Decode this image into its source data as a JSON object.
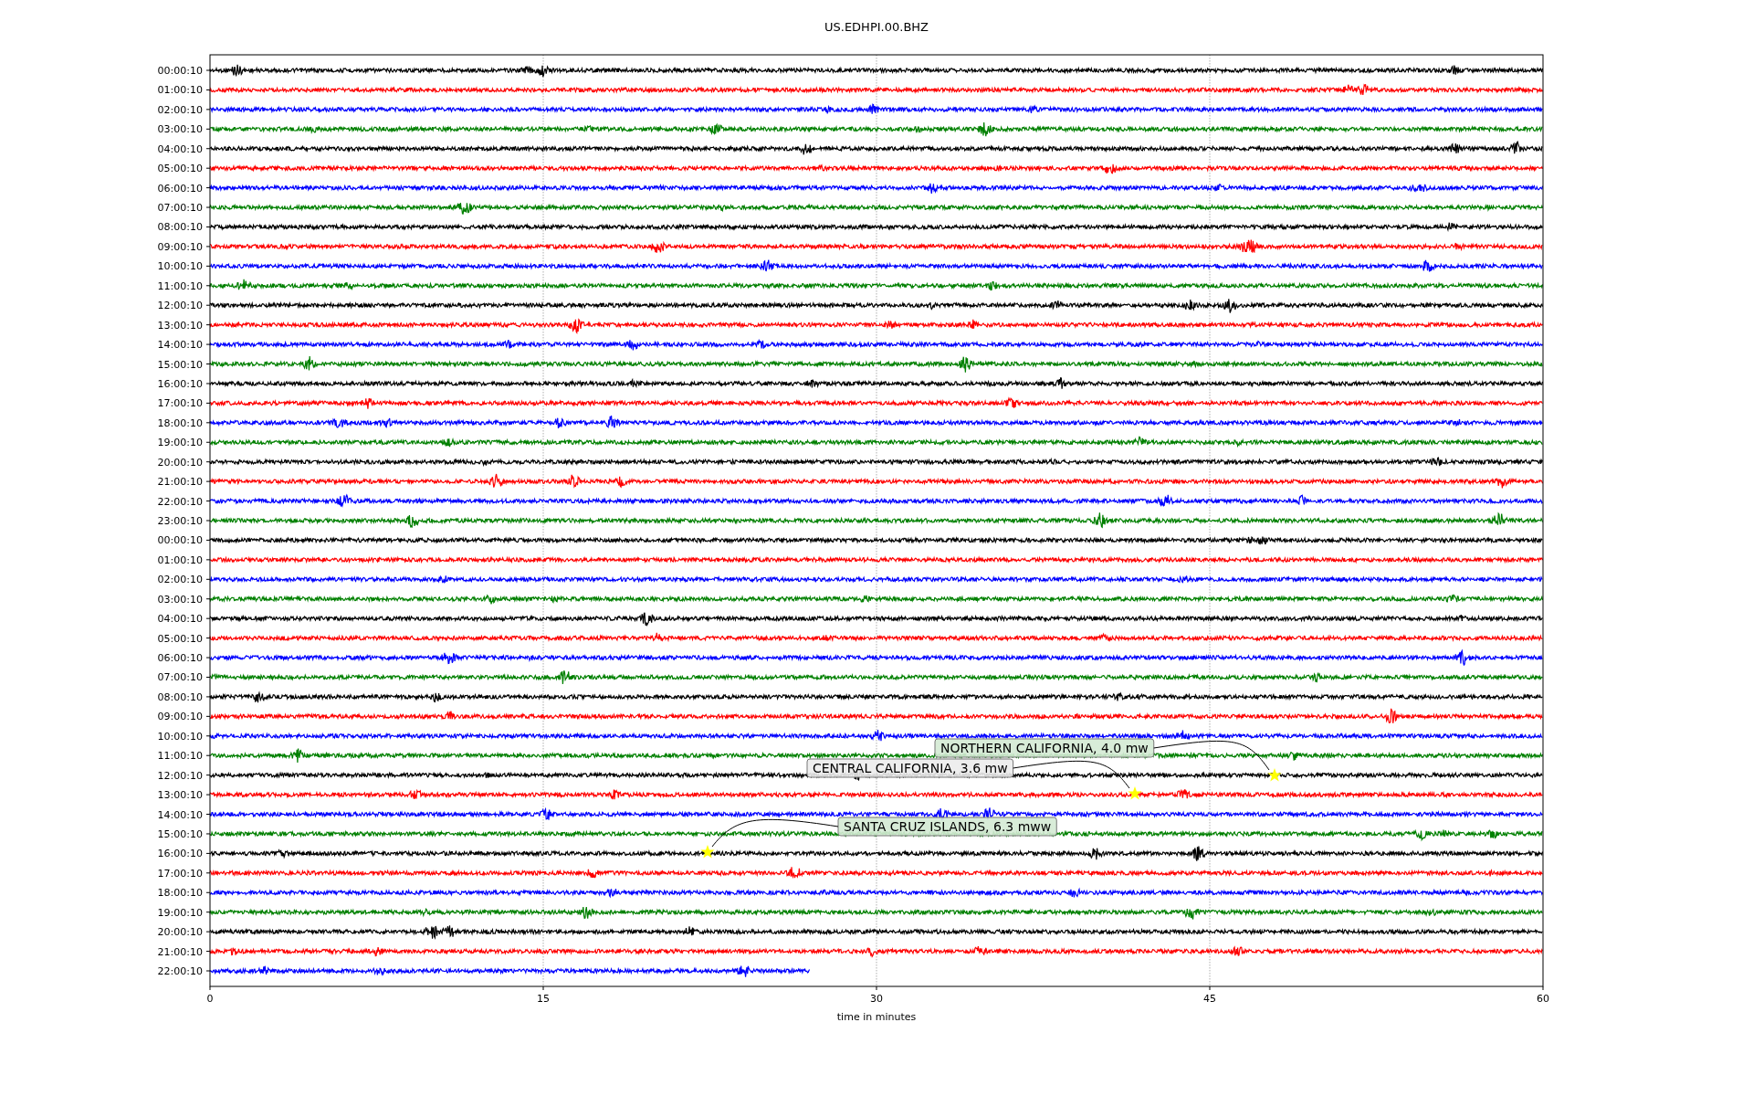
{
  "title": "US.EDHPI.00.BHZ",
  "rows": [
    {
      "label": "00:00:10",
      "color": "#000000",
      "level": 1
    },
    {
      "label": "01:00:10",
      "color": "#ff0000",
      "level": 1
    },
    {
      "label": "02:00:10",
      "color": "#0000ff",
      "level": 1
    },
    {
      "label": "03:00:10",
      "color": "#008000",
      "level": 1
    },
    {
      "label": "04:00:10",
      "color": "#000000",
      "level": 1
    },
    {
      "label": "05:00:10",
      "color": "#ff0000",
      "level": 1
    },
    {
      "label": "06:00:10",
      "color": "#0000ff",
      "level": 1
    },
    {
      "label": "07:00:10",
      "color": "#008000",
      "level": 1
    },
    {
      "label": "08:00:10",
      "color": "#000000",
      "level": 1
    },
    {
      "label": "09:00:10",
      "color": "#ff0000",
      "level": 1
    },
    {
      "label": "10:00:10",
      "color": "#0000ff",
      "level": 1
    },
    {
      "label": "11:00:10",
      "color": "#008000",
      "level": 1
    },
    {
      "label": "12:00:10",
      "color": "#000000",
      "level": 1
    },
    {
      "label": "13:00:10",
      "color": "#ff0000",
      "level": 1
    },
    {
      "label": "14:00:10",
      "color": "#0000ff",
      "level": 1
    },
    {
      "label": "15:00:10",
      "color": "#008000",
      "level": 1
    },
    {
      "label": "16:00:10",
      "color": "#000000",
      "level": 1
    },
    {
      "label": "17:00:10",
      "color": "#ff0000",
      "level": 1
    },
    {
      "label": "18:00:10",
      "color": "#0000ff",
      "level": 1
    },
    {
      "label": "19:00:10",
      "color": "#008000",
      "level": 1
    },
    {
      "label": "20:00:10",
      "color": "#000000",
      "level": 1
    },
    {
      "label": "21:00:10",
      "color": "#ff0000",
      "level": 1
    },
    {
      "label": "22:00:10",
      "color": "#0000ff",
      "level": 1
    },
    {
      "label": "23:00:10",
      "color": "#008000",
      "level": 1
    },
    {
      "label": "00:00:10",
      "color": "#000000",
      "level": 1
    },
    {
      "label": "01:00:10",
      "color": "#ff0000",
      "level": 1
    },
    {
      "label": "02:00:10",
      "color": "#0000ff",
      "level": 1
    },
    {
      "label": "03:00:10",
      "color": "#008000",
      "level": 1
    },
    {
      "label": "04:00:10",
      "color": "#000000",
      "level": 1
    },
    {
      "label": "05:00:10",
      "color": "#ff0000",
      "level": 1
    },
    {
      "label": "06:00:10",
      "color": "#0000ff",
      "level": 1
    },
    {
      "label": "07:00:10",
      "color": "#008000",
      "level": 1
    },
    {
      "label": "08:00:10",
      "color": "#000000",
      "level": 1
    },
    {
      "label": "09:00:10",
      "color": "#ff0000",
      "level": 1
    },
    {
      "label": "10:00:10",
      "color": "#0000ff",
      "level": 1
    },
    {
      "label": "11:00:10",
      "color": "#008000",
      "level": 1
    },
    {
      "label": "12:00:10",
      "color": "#000000",
      "level": 1
    },
    {
      "label": "13:00:10",
      "color": "#ff0000",
      "level": 1
    },
    {
      "label": "14:00:10",
      "color": "#0000ff",
      "level": 1
    },
    {
      "label": "15:00:10",
      "color": "#008000",
      "level": 1
    },
    {
      "label": "16:00:10",
      "color": "#000000",
      "level": 1
    },
    {
      "label": "17:00:10",
      "color": "#ff0000",
      "level": 1
    },
    {
      "label": "18:00:10",
      "color": "#0000ff",
      "level": 1
    },
    {
      "label": "19:00:10",
      "color": "#008000",
      "level": 1
    },
    {
      "label": "20:00:10",
      "color": "#000000",
      "level": 1
    },
    {
      "label": "21:00:10",
      "color": "#ff0000",
      "level": 1
    },
    {
      "label": "22:00:10",
      "color": "#0000ff",
      "level": 0.45
    }
  ],
  "x_ticks": [
    "0",
    "15",
    "30",
    "45",
    "60"
  ],
  "x_label": "time in minutes",
  "events": [
    {
      "text": "NORTHERN CALIFORNIA, 4.0 mw"
    },
    {
      "text": "CENTRAL CALIFORNIA, 3.6 mw"
    },
    {
      "text": "SANTA CRUZ ISLANDS, 6.3 mww"
    }
  ]
}
